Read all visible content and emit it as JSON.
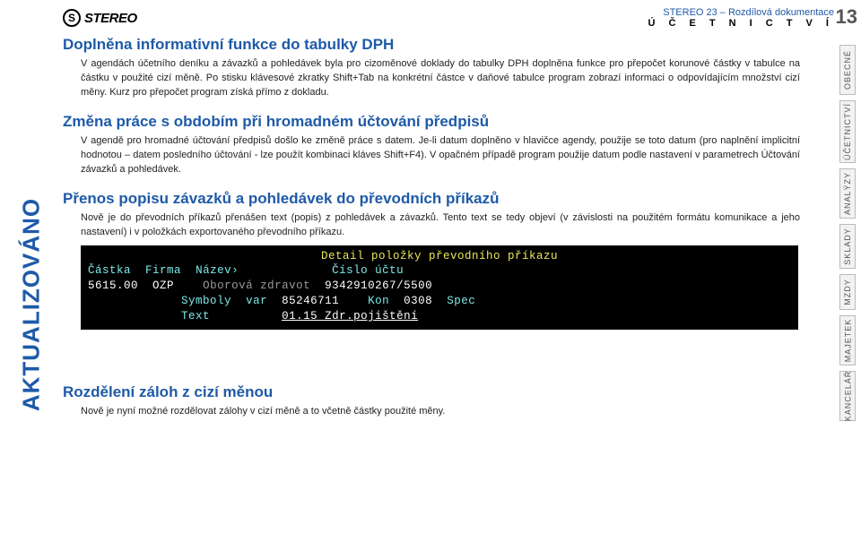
{
  "header": {
    "logo_letter": "S",
    "logo_text": "STEREO",
    "doc_line": "STEREO 23 – Rozdílová dokumentace",
    "section": "Ú Č E T N I C T V Í",
    "page": "13"
  },
  "left_vertical": "AKTUALIZOVÁNO",
  "right_tabs": [
    "OBECNÉ",
    "ÚČETNICTVÍ",
    "ANALÝZY",
    "SKLADY",
    "MZDY",
    "MAJETEK",
    "KANCELÁŘ"
  ],
  "right_tab_heights": [
    56,
    70,
    56,
    50,
    40,
    56,
    56
  ],
  "sections": {
    "s1_h": "Doplněna informativní funkce do tabulky DPH",
    "s1_p": "V agendách účetního deníku a závazků a pohledávek byla pro cizoměnové doklady do tabulky DPH doplněna funkce pro přepočet korunové částky v tabulce na částku v použité cizí měně. Po stisku klávesové zkratky Shift+Tab na konkrétní částce v daňové tabulce program zobrazí informaci o odpovídajícím množství cizí měny. Kurz pro přepočet program získá přímo z dokladu.",
    "s2_h": "Změna práce s obdobím při hromadném účtování předpisů",
    "s2_p": "V agendě pro hromadné účtování předpisů došlo ke změně práce s datem. Je-li datum doplněno v hlavičce agendy, použije se toto datum (pro naplnění implicitní hodnotou – datem posledního účtování - lze použít kombinaci kláves Shift+F4). V opačném případě program použije datum podle nastavení v parametrech Účtování závazků a pohledávek.",
    "s3_h": "Přenos popisu závazků a pohledávek do převodních příkazů",
    "s3_p": "Nově je do převodních příkazů přenášen text (popis) z pohledávek a závazků. Tento text se tedy objeví (v závislosti na použitém formátu komunikace a jeho nastavení) i v položkách exportovaného převodního příkazu.",
    "s4_h": "Rozdělení záloh z cizí měnou",
    "s4_p": "Nově je nyní možné rozdělovat zálohy v cizí měně a to včetně částky použité měny."
  },
  "terminal": {
    "title": "Detail položky převodního příkazu",
    "row1": {
      "col1": "Částka",
      "col2": "Firma",
      "col3": "Název›",
      "col4": "Číslo účtu"
    },
    "row2": {
      "amount": "5615.00",
      "firm": "OZP",
      "name": "Oborová zdravot",
      "acct": "9342910267/5500"
    },
    "row3": {
      "lbl1": "Symboly",
      "lbl2": "var",
      "v2": "85246711",
      "lbl3": "Kon",
      "v3": "0308",
      "lbl4": "Spec"
    },
    "row4": {
      "lbl": "Text",
      "val": "01.15 Zdr.pojištění"
    }
  }
}
